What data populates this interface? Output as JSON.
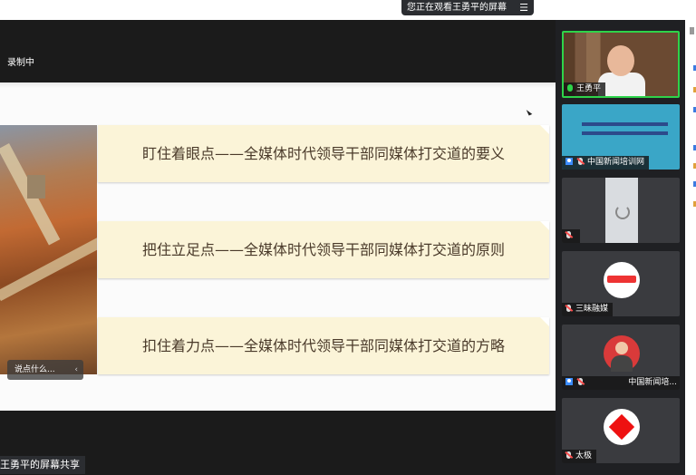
{
  "banner": {
    "viewing_text": "您正在观看王勇平的屏幕",
    "menu_glyph": "☰"
  },
  "recording": {
    "label": "录制中"
  },
  "slide": {
    "headings": [
      "盯住着眼点——全媒体时代领导干部同媒体打交道的要义",
      "把住立足点——全媒体时代领导干部同媒体打交道的原则",
      "扣住着力点——全媒体时代领导干部同媒体打交道的方略"
    ]
  },
  "comment": {
    "placeholder": "说点什么...",
    "collapse_glyph": "‹"
  },
  "share": {
    "label": "王勇平的屏幕共享"
  },
  "participants": [
    {
      "name": "王勇平"
    },
    {
      "name": "中国新闻培训网"
    },
    {
      "name": ""
    },
    {
      "name": "三昧融媒"
    },
    {
      "name": "中国新闻培..."
    },
    {
      "name": "太极"
    }
  ],
  "colors": {
    "active_speaker": "#2ed34a",
    "heading_bg": "#fbf4d8",
    "dark_bg": "#1b1b1b"
  }
}
